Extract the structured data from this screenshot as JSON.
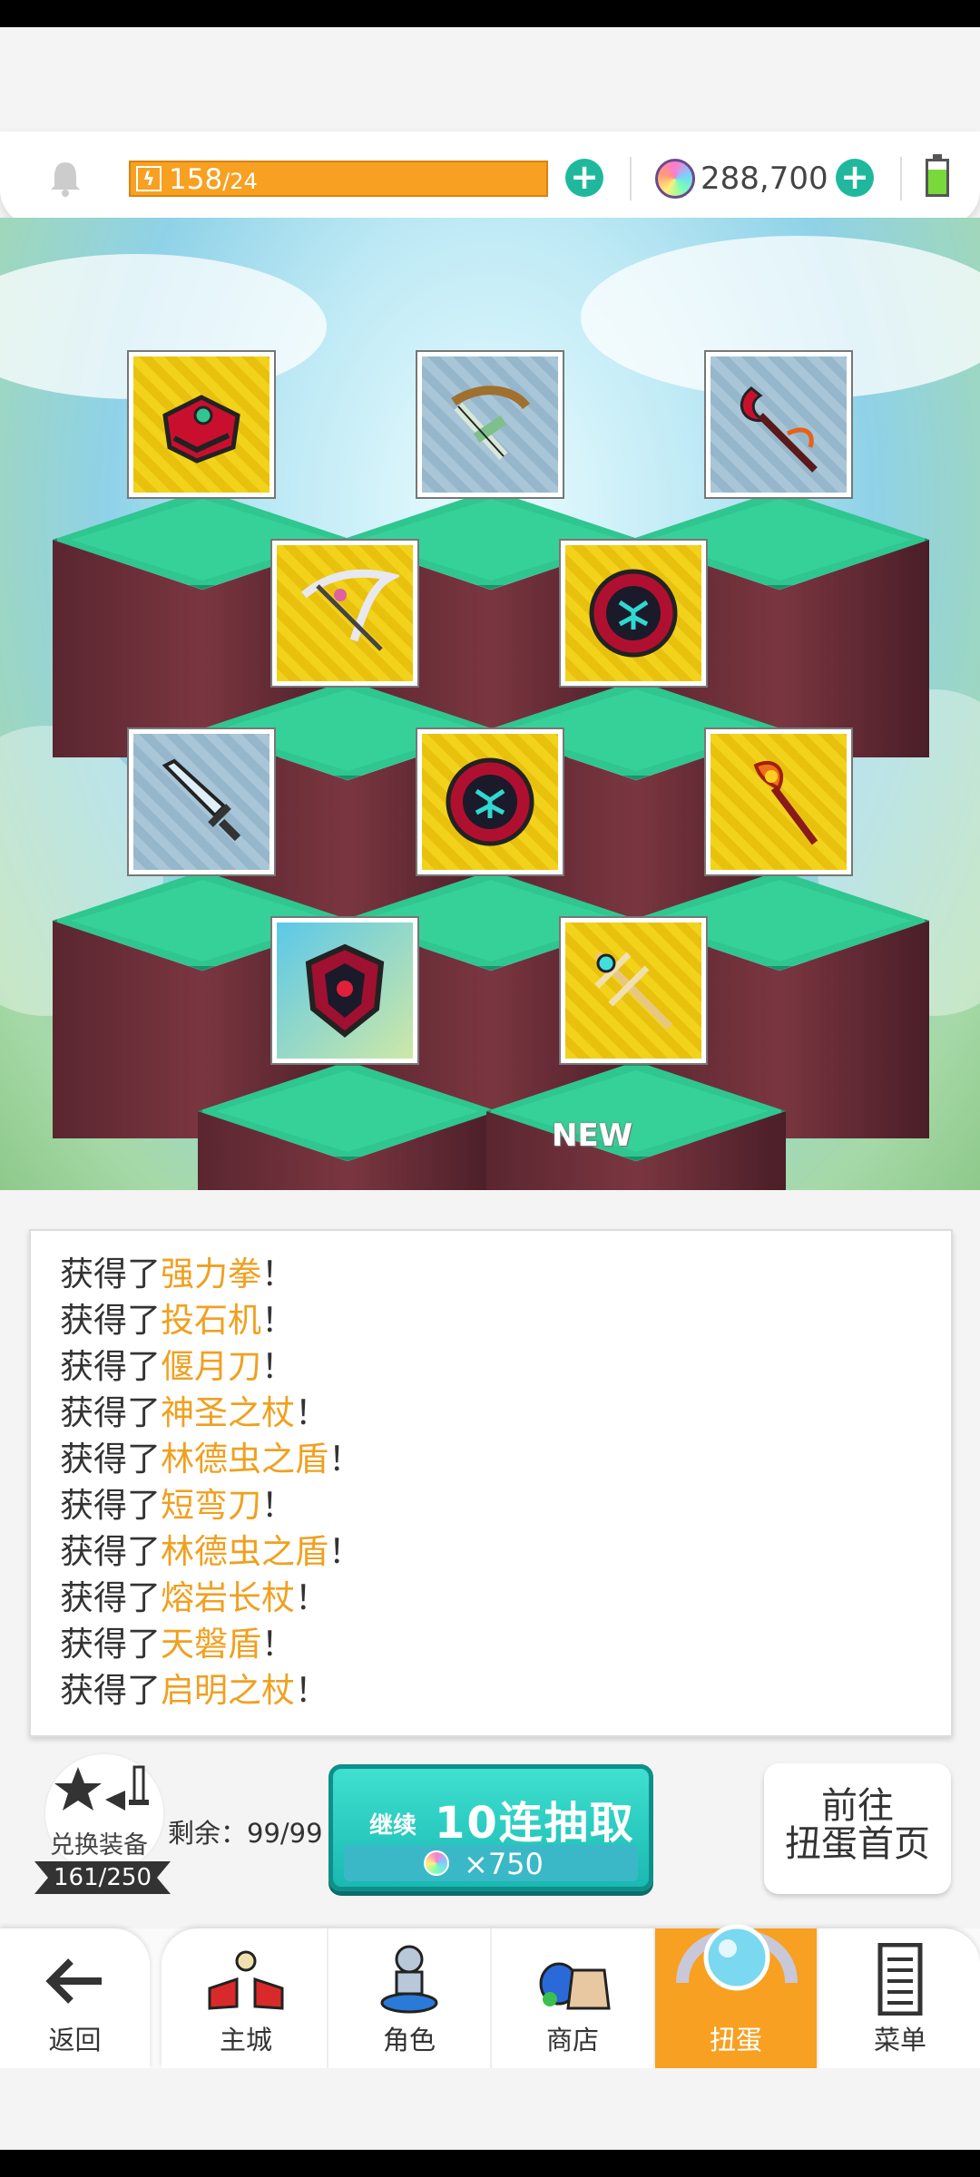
{
  "header": {
    "energy_current": "158",
    "energy_max": "/24",
    "gem_count": "288,700"
  },
  "scene": {
    "new_tag": "NEW",
    "items": [
      {
        "name": "red-gauntlet-icon",
        "style": "gold"
      },
      {
        "name": "catapult-icon",
        "style": "blue"
      },
      {
        "name": "crescent-blade-icon",
        "style": "blue"
      },
      {
        "name": "crossbow-icon",
        "style": "gold"
      },
      {
        "name": "round-shield-icon",
        "style": "gold"
      },
      {
        "name": "short-sword-icon",
        "style": "blue"
      },
      {
        "name": "round-shield-icon",
        "style": "gold"
      },
      {
        "name": "lava-staff-icon",
        "style": "gold"
      },
      {
        "name": "heaven-shield-icon",
        "style": "blue"
      },
      {
        "name": "holy-staff-icon",
        "style": "gold"
      }
    ]
  },
  "log": {
    "prefix": "获得了",
    "suffix": "！",
    "entries": [
      "强力拳",
      "投石机",
      "偃月刀",
      "神圣之杖",
      "林德虫之盾",
      "短弯刀",
      "林德虫之盾",
      "熔岩长杖",
      "天磐盾",
      "启明之杖"
    ]
  },
  "actions": {
    "exchange_label": "兑换装备",
    "exchange_count": "161/250",
    "remaining": "剩余：99/99",
    "draw_continue": "继续",
    "draw_title": "10连抽取",
    "draw_cost": "×750",
    "home_line1": "前往",
    "home_line2": "扭蛋首页"
  },
  "nav": {
    "back": "返回",
    "tabs": [
      "主城",
      "角色",
      "商店",
      "扭蛋",
      "菜单"
    ],
    "active_tab": "扭蛋"
  },
  "colors": {
    "accent_orange": "#f7a021",
    "teal": "#1fb89c",
    "item_name": "#f0a020"
  }
}
